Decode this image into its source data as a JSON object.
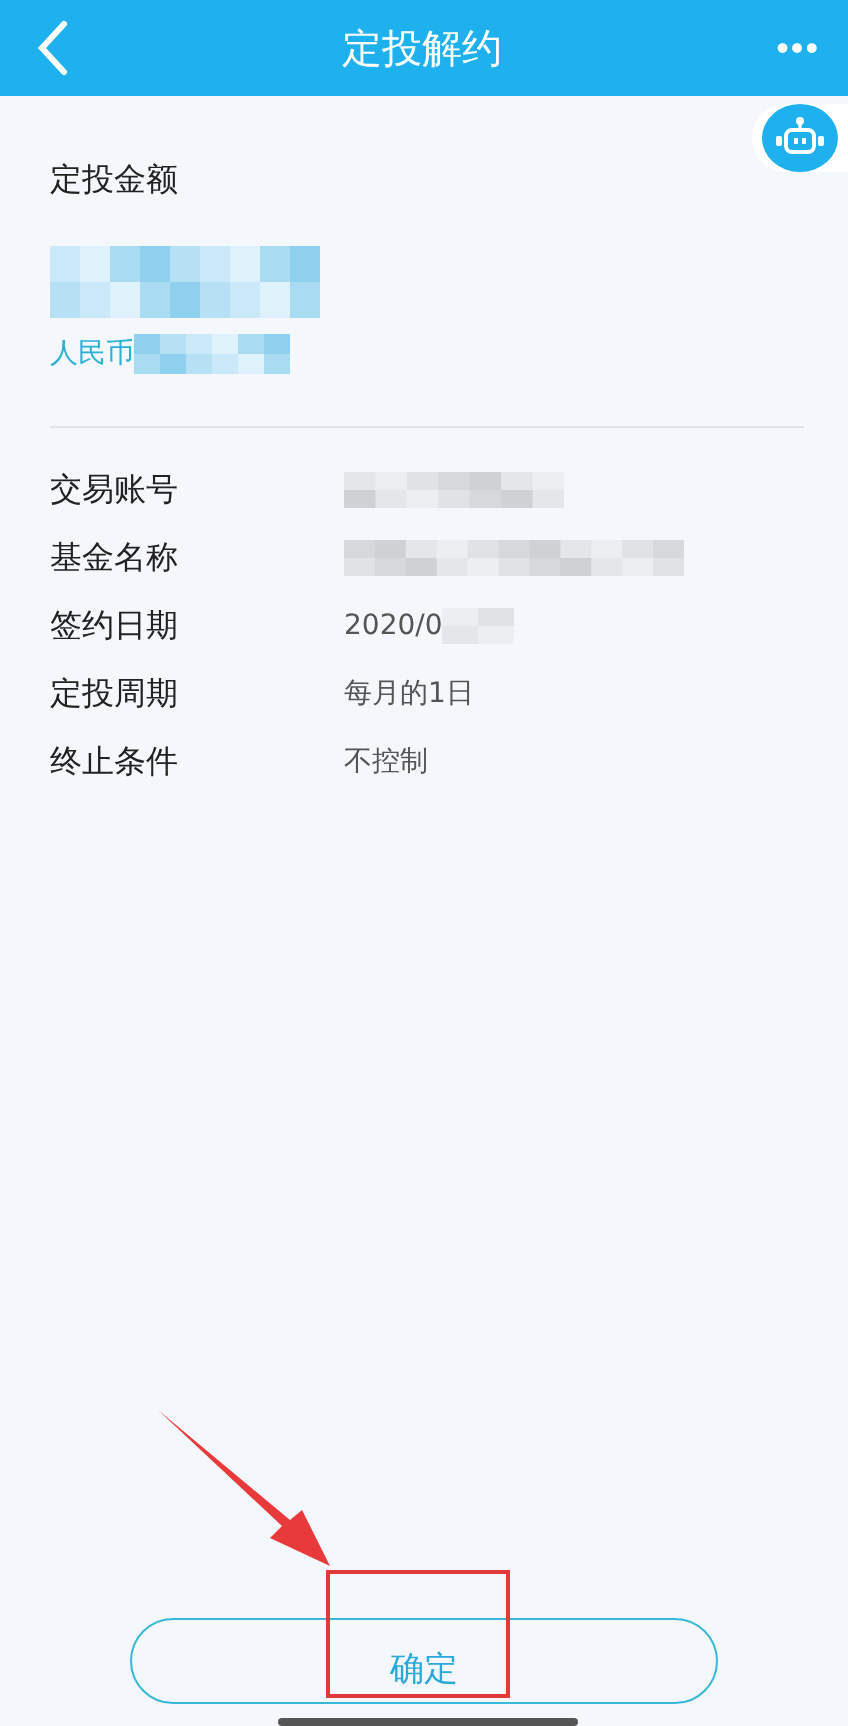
{
  "header": {
    "title": "定投解约",
    "more": "•••"
  },
  "amount": {
    "label": "定投金额",
    "currency": "人民币"
  },
  "rows": [
    {
      "label": "交易账号",
      "value": "",
      "redacted": true
    },
    {
      "label": "基金名称",
      "value": "",
      "redacted": true
    },
    {
      "label": "签约日期",
      "value": "2020/0",
      "redacted": true
    },
    {
      "label": "定投周期",
      "value": "每月的1日",
      "redacted": false
    },
    {
      "label": "终止条件",
      "value": "不控制",
      "redacted": false
    }
  ],
  "confirm_button": "确定"
}
